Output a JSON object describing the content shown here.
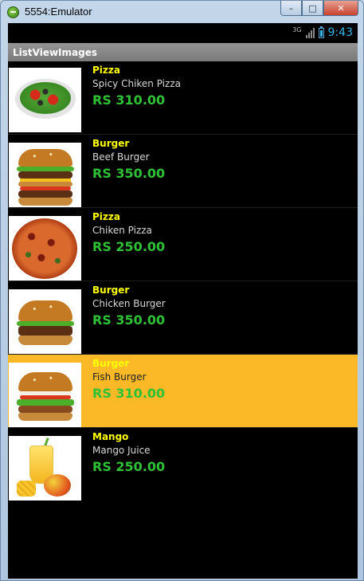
{
  "window": {
    "title": "5554:Emulator",
    "controls": {
      "minimize": "–",
      "maximize": "□",
      "close": "✕"
    }
  },
  "status_bar": {
    "network": "3G",
    "time": "9:43",
    "colors": {
      "accent": "#33b5e5"
    }
  },
  "action_bar": {
    "title": "ListViewImages"
  },
  "list": {
    "items": [
      {
        "name": "Pizza",
        "description": "Spicy Chiken Pizza",
        "price": "RS 310.00",
        "image": "salad-pizza-image",
        "selected": false
      },
      {
        "name": "Burger",
        "description": "Beef Burger",
        "price": "RS 350.00",
        "image": "double-burger-image",
        "selected": false
      },
      {
        "name": "Pizza",
        "description": "Chiken Pizza",
        "price": "RS 250.00",
        "image": "round-pizza-image",
        "selected": false
      },
      {
        "name": "Burger",
        "description": "Chicken Burger",
        "price": "RS 350.00",
        "image": "chicken-burger-image",
        "selected": false
      },
      {
        "name": "Burger",
        "description": "Fish Burger",
        "price": "RS 310.00",
        "image": "fish-burger-image",
        "selected": true
      },
      {
        "name": "Mango",
        "description": "Mango Juice",
        "price": "RS 250.00",
        "image": "mango-juice-image",
        "selected": false
      }
    ]
  },
  "colors": {
    "name_text": "#ffff00",
    "price_text": "#2fc135",
    "selected_row": "#fbb927",
    "background": "#000000"
  }
}
